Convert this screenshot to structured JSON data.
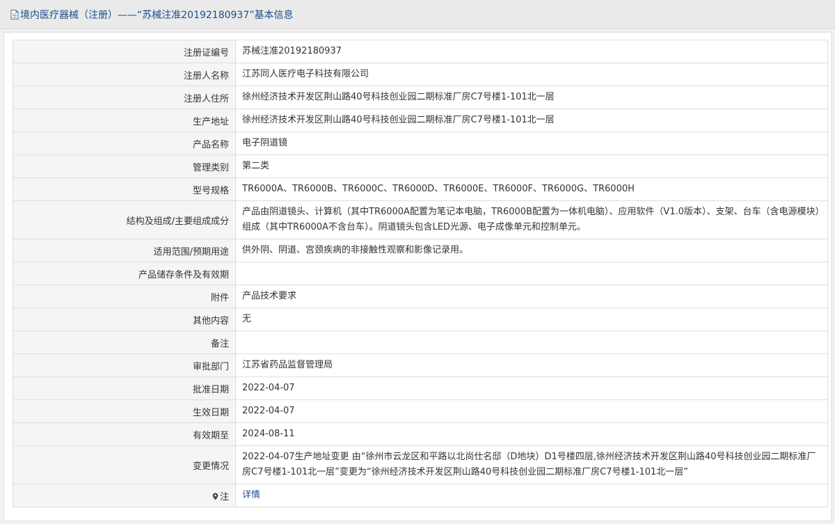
{
  "header": {
    "title": "境内医疗器械（注册）——“苏械注准20192180937”基本信息"
  },
  "rows": [
    {
      "label": "注册证编号",
      "value": "苏械注准20192180937"
    },
    {
      "label": "注册人名称",
      "value": "江苏同人医疗电子科技有限公司"
    },
    {
      "label": "注册人住所",
      "value": "徐州经济技术开发区荆山路40号科技创业园二期标准厂房C7号楼1-101北一层"
    },
    {
      "label": "生产地址",
      "value": "徐州经济技术开发区荆山路40号科技创业园二期标准厂房C7号楼1-101北一层"
    },
    {
      "label": "产品名称",
      "value": "电子阴道镜"
    },
    {
      "label": "管理类别",
      "value": "第二类"
    },
    {
      "label": "型号规格",
      "value": "TR6000A、TR6000B、TR6000C、TR6000D、TR6000E、TR6000F、TR6000G、TR6000H"
    },
    {
      "label": "结构及组成/主要组成成分",
      "value": "产品由阴道镜头、计算机（其中TR6000A配置为笔记本电脑，TR6000B配置为一体机电脑）、应用软件（V1.0版本）、支架、台车（含电源模块）组成（其中TR6000A不含台车）。阴道镜头包含LED光源、电子成像单元和控制单元。"
    },
    {
      "label": "适用范围/预期用途",
      "value": "供外阴、阴道、宫颈疾病的非接触性观察和影像记录用。"
    },
    {
      "label": "产品储存条件及有效期",
      "value": ""
    },
    {
      "label": "附件",
      "value": "产品技术要求"
    },
    {
      "label": "其他内容",
      "value": "无"
    },
    {
      "label": "备注",
      "value": ""
    },
    {
      "label": "审批部门",
      "value": "江苏省药品监督管理局"
    },
    {
      "label": "批准日期",
      "value": "2022-04-07"
    },
    {
      "label": "生效日期",
      "value": "2022-04-07"
    },
    {
      "label": "有效期至",
      "value": "2024-08-11"
    },
    {
      "label": "变更情况",
      "value": "2022-04-07生产地址变更 由“徐州市云龙区和平路以北尚仕名邸（D地块）D1号楼四层,徐州经济技术开发区荆山路40号科技创业园二期标准厂房C7号楼1-101北一层”变更为“徐州经济技术开发区荆山路40号科技创业园二期标准厂房C7号楼1-101北一层”"
    }
  ],
  "footer_row": {
    "label": "注",
    "link_text": "详情"
  },
  "icons": {
    "title_icon": "document-icon",
    "note_icon": "pin-icon"
  },
  "colors": {
    "title_text": "#1a4e8a",
    "label_bg": "#f5f5f5",
    "border": "#dedede",
    "link": "#1a4e8a"
  }
}
